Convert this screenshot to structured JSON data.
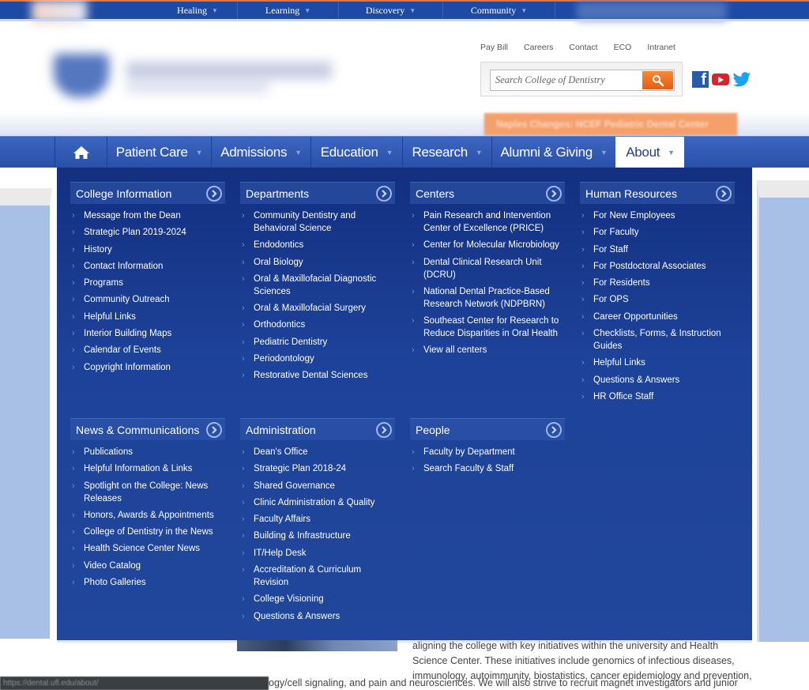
{
  "top_nav": {
    "items": [
      {
        "label": "Healing"
      },
      {
        "label": "Learning"
      },
      {
        "label": "Discovery"
      },
      {
        "label": "Community"
      }
    ]
  },
  "utility_links": [
    "Pay Bill",
    "Careers",
    "Contact",
    "ECO",
    "Intranet"
  ],
  "search": {
    "placeholder": "Search College of Dentistry",
    "value": ""
  },
  "social": [
    "facebook-icon",
    "youtube-icon",
    "twitter-icon"
  ],
  "alert_banner": "Naples Changes: NCEF Pediatric Dental Center",
  "main_nav": {
    "items": [
      {
        "label": "Patient Care"
      },
      {
        "label": "Admissions"
      },
      {
        "label": "Education"
      },
      {
        "label": "Research"
      },
      {
        "label": "Alumni & Giving"
      },
      {
        "label": "About",
        "active": true
      }
    ]
  },
  "mega_menu": {
    "columns": [
      {
        "title": "College Information",
        "items": [
          "Message from the Dean",
          "Strategic Plan 2019-2024",
          "History",
          "Contact Information",
          "Programs",
          "Community Outreach",
          "Helpful Links",
          "Interior Building Maps",
          "Calendar of Events",
          "Copyright Information"
        ]
      },
      {
        "title": "Departments",
        "items": [
          "Community Dentistry and Behavioral Science",
          "Endodontics",
          "Oral Biology",
          "Oral & Maxillofacial Diagnostic Sciences",
          "Oral & Maxillofacial Surgery",
          "Orthodontics",
          "Pediatric Dentistry",
          "Periodontology",
          "Restorative Dental Sciences"
        ]
      },
      {
        "title": "Centers",
        "items": [
          "Pain Research and Intervention Center of Excellence (PRICE)",
          "Center for Molecular Microbiology",
          "Dental Clinical Research Unit (DCRU)",
          "National Dental Practice-Based Research Network (NDPBRN)",
          "Southeast Center for Research to Reduce Disparities in Oral Health",
          "View all centers"
        ]
      },
      {
        "title": "Human Resources",
        "items": [
          "For New Employees",
          "For Faculty",
          "For Staff",
          "For Postdoctoral Associates",
          "For Residents",
          "For OPS",
          "Career Opportunities",
          "Checklists, Forms, & Instruction Guides",
          "Helpful Links",
          "Questions & Answers",
          "HR Office Staff"
        ]
      },
      {
        "title": "News & Communications",
        "items": [
          "Publications",
          "Helpful Information & Links",
          "Spotlight on the College: News Releases",
          "Honors, Awards & Appointments",
          "College of Dentistry in the News",
          "Health Science Center News",
          "Video Catalog",
          "Photo Galleries"
        ]
      },
      {
        "title": "Administration",
        "items": [
          "Dean's Office",
          "Strategic Plan 2018-24",
          "Shared Governance",
          "Clinic Administration & Quality",
          "Faculty Affairs",
          "Building & Infrastructure",
          "IT/Help Desk",
          "Accreditation & Curriculum Revision",
          "College Visioning",
          "Questions & Answers"
        ]
      },
      {
        "title": "People",
        "items": [
          "Faculty by Department",
          "Search Faculty & Staff"
        ]
      }
    ]
  },
  "body_text": {
    "para": "aligning the college with key initiatives within the university and Health Science Center. These initiatives include genomics of infectious diseases, immunology, autoimmunity, biostatistics, cancer epidemiology and prevention,",
    "para_cont": "ogy/cell signaling, and pain and neurosciences. We will also strive to recruit magnet investigators and junior"
  },
  "status_bar_url": "https://dental.ufl.edu/about/",
  "colors": {
    "brand_blue": "#1f4aa3",
    "accent_orange": "#e8733a",
    "menu_bg": "#1d4299"
  }
}
